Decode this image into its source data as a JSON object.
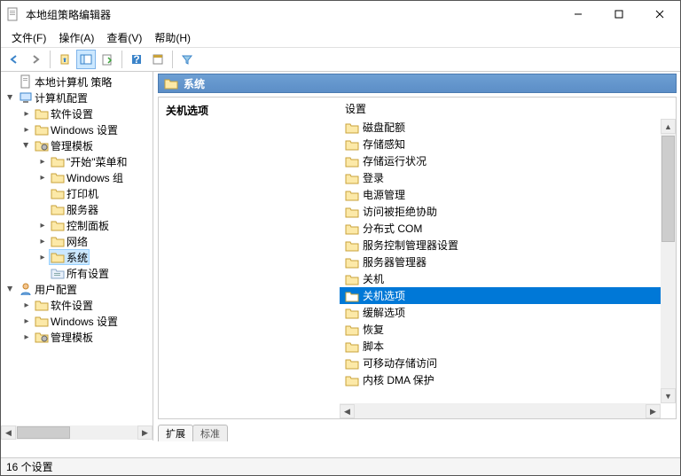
{
  "window": {
    "title": "本地组策略编辑器"
  },
  "menu": {
    "file": "文件(F)",
    "action": "操作(A)",
    "view": "查看(V)",
    "help": "帮助(H)"
  },
  "tree": {
    "root": "本地计算机 策略",
    "computer_config": "计算机配置",
    "cc_software": "软件设置",
    "cc_windows": "Windows 设置",
    "cc_admin_templates": "管理模板",
    "cc_at_start": "\"开始\"菜单和",
    "cc_at_wincomp": "Windows 组",
    "cc_at_printer": "打印机",
    "cc_at_server": "服务器",
    "cc_at_control": "控制面板",
    "cc_at_network": "网络",
    "cc_at_system": "系统",
    "cc_at_all": "所有设置",
    "user_config": "用户配置",
    "uc_software": "软件设置",
    "uc_windows": "Windows 设置",
    "uc_admin_templates": "管理模板"
  },
  "content": {
    "header": "系统",
    "left_title": "关机选项",
    "column_header": "设置"
  },
  "items": [
    "磁盘配额",
    "存储感知",
    "存储运行状况",
    "登录",
    "电源管理",
    "访问被拒绝协助",
    "分布式 COM",
    "服务控制管理器设置",
    "服务器管理器",
    "关机",
    "关机选项",
    "缓解选项",
    "恢复",
    "脚本",
    "可移动存储访问",
    "内核 DMA 保护"
  ],
  "selected_item_index": 10,
  "tabs": {
    "extended": "扩展",
    "standard": "标准"
  },
  "status": "16 个设置"
}
